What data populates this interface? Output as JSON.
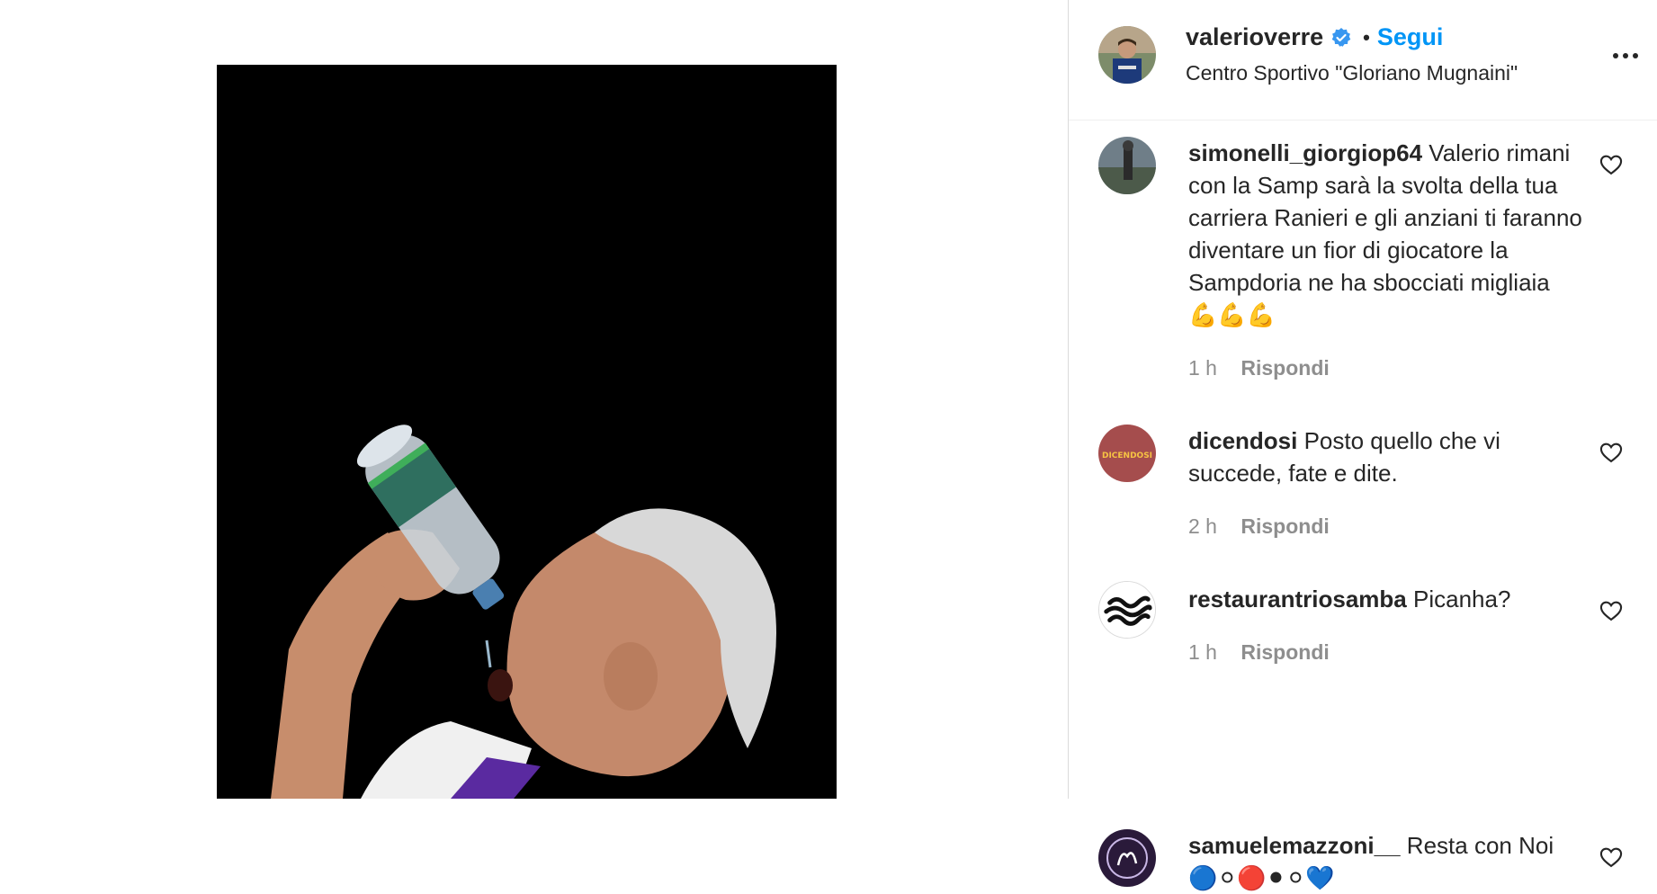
{
  "post": {
    "username": "valerioverre",
    "separator": "•",
    "follow_label": "Segui",
    "location": "Centro Sportivo \"Gloriano Mugnaini\""
  },
  "icons": {
    "verified": "verified-badge-icon",
    "more": "more-options-icon",
    "like": "heart-icon"
  },
  "colors": {
    "accent": "#0095f6",
    "text": "#262626",
    "muted": "#8e8e8e"
  },
  "comments": [
    {
      "username": "simonelli_giorgiop64",
      "text": "Valerio rimani con la Samp sarà la svolta della tua carriera Ranieri e gli anziani ti faranno diventare un fior di giocatore la Sampdoria ne ha sbocciati migliaia 💪💪💪",
      "time": "1 h",
      "reply_label": "Rispondi"
    },
    {
      "username": "dicendosi",
      "avatar_text": "DICENDOSI",
      "text": "Posto quello che vi succede, fate e dite.",
      "time": "2 h",
      "reply_label": "Rispondi"
    },
    {
      "username": "restaurantriosamba",
      "text": "Picanha?",
      "time": "1 h",
      "reply_label": "Rispondi"
    },
    {
      "username": "samuelemazzoni__",
      "text": "Resta con Noi 🔵⚪🔴⚫⚪💙"
    }
  ]
}
